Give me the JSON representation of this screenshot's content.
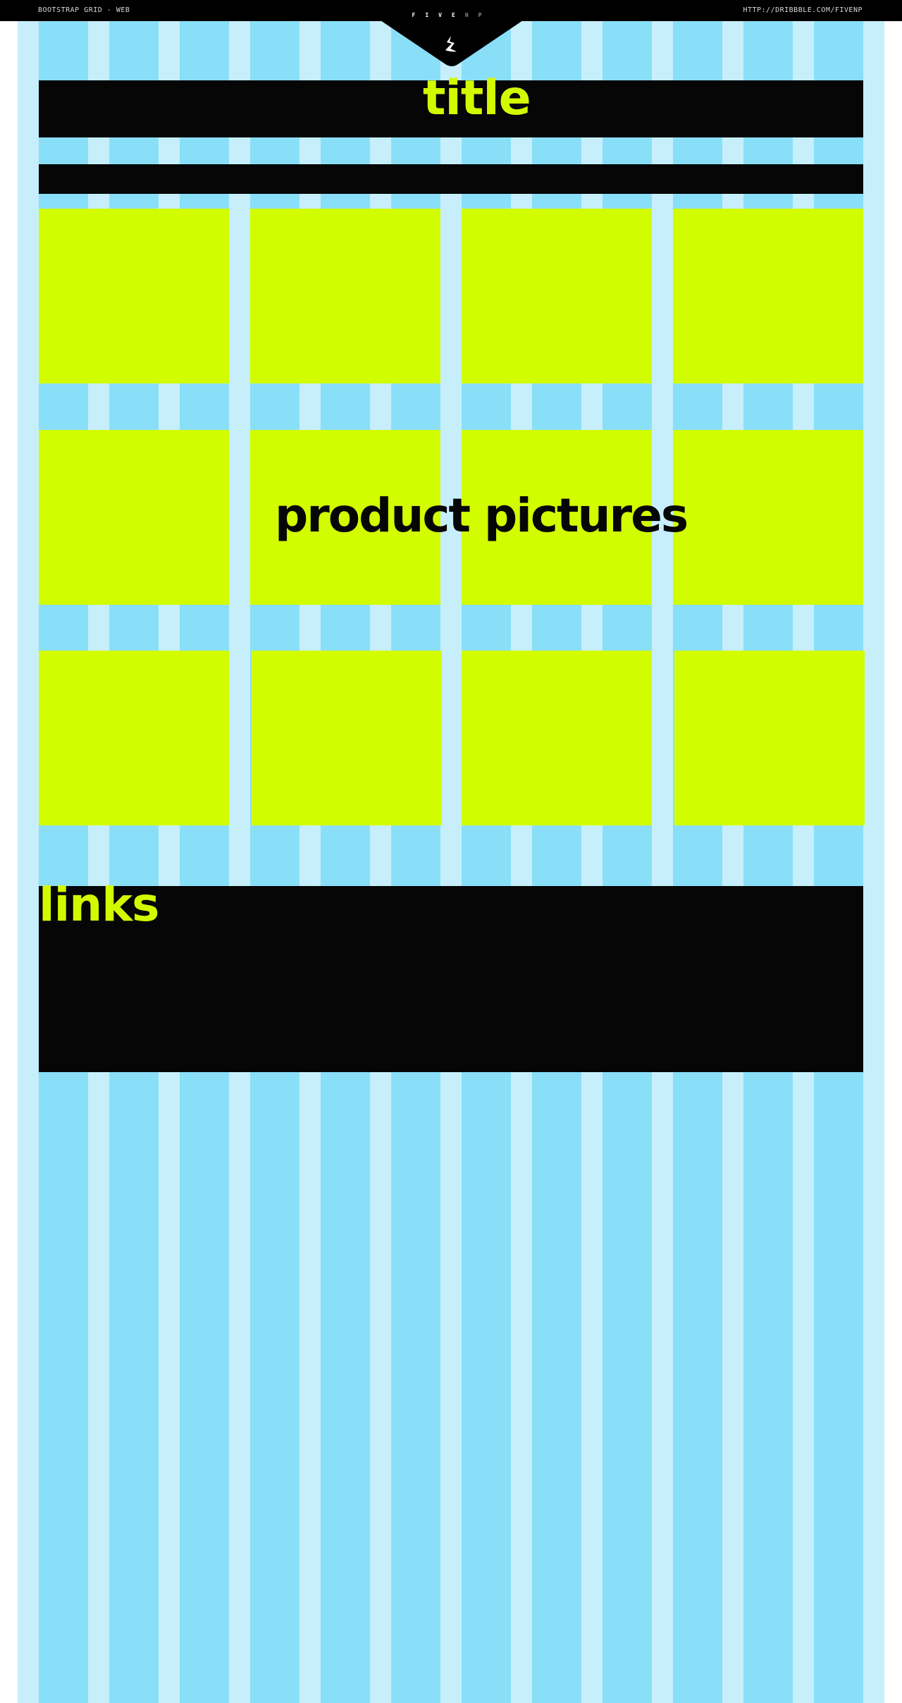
{
  "header": {
    "left_label": "BOOTSTRAP GRID - WEB",
    "right_label": "HTTP://DRIBBBLE.COM/FIVENP",
    "brand_main": "FIVE",
    "brand_tail": "NP"
  },
  "sections": {
    "title": "title",
    "products": "product pictures",
    "links": "links"
  },
  "grid": {
    "columns": 12,
    "product_rows": 3,
    "product_columns": 4
  },
  "colors": {
    "page": "#ffffff",
    "gutter": "#c6effb",
    "column": "#8adff8",
    "dark": "#060606",
    "accent": "#d2fd00"
  },
  "icons": {
    "logo": "lightning-bolt-icon"
  }
}
